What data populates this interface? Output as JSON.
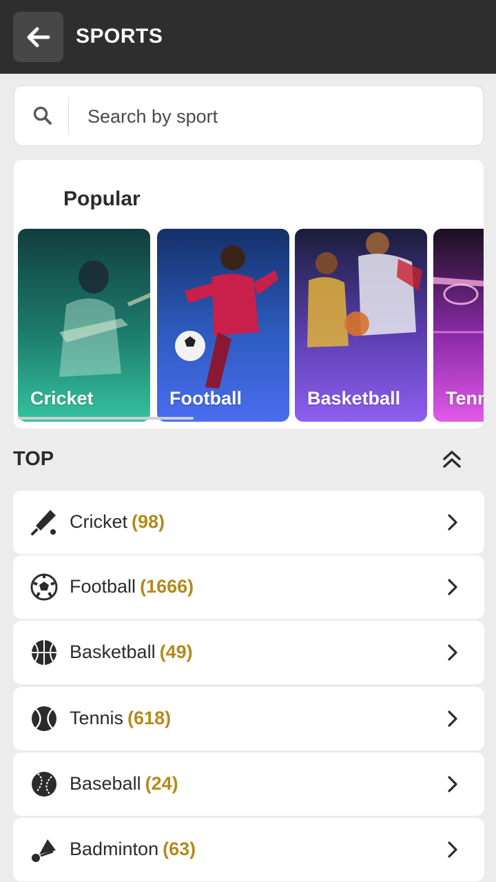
{
  "header": {
    "title": "SPORTS",
    "back_icon": "arrow-left-icon"
  },
  "search": {
    "placeholder": "Search by sport",
    "value": "",
    "icon": "search-icon"
  },
  "popular": {
    "title": "Popular",
    "tiles": [
      {
        "label": "Cricket"
      },
      {
        "label": "Football"
      },
      {
        "label": "Basketball"
      },
      {
        "label": "Tennis"
      }
    ]
  },
  "top": {
    "title": "TOP",
    "collapse_icon": "double-chevron-up-icon",
    "sports": [
      {
        "name": "Cricket",
        "count": "(98)",
        "icon": "cricket-bat-icon"
      },
      {
        "name": "Football",
        "count": "(1666)",
        "icon": "soccer-ball-icon"
      },
      {
        "name": "Basketball",
        "count": "(49)",
        "icon": "basketball-icon"
      },
      {
        "name": "Tennis",
        "count": "(618)",
        "icon": "tennis-ball-icon"
      },
      {
        "name": "Baseball",
        "count": "(24)",
        "icon": "baseball-icon"
      },
      {
        "name": "Badminton",
        "count": "(63)",
        "icon": "shuttlecock-icon"
      }
    ]
  },
  "colors": {
    "header_bg": "#2e2e2e",
    "page_bg": "#ececec",
    "count": "#b38a1a"
  }
}
